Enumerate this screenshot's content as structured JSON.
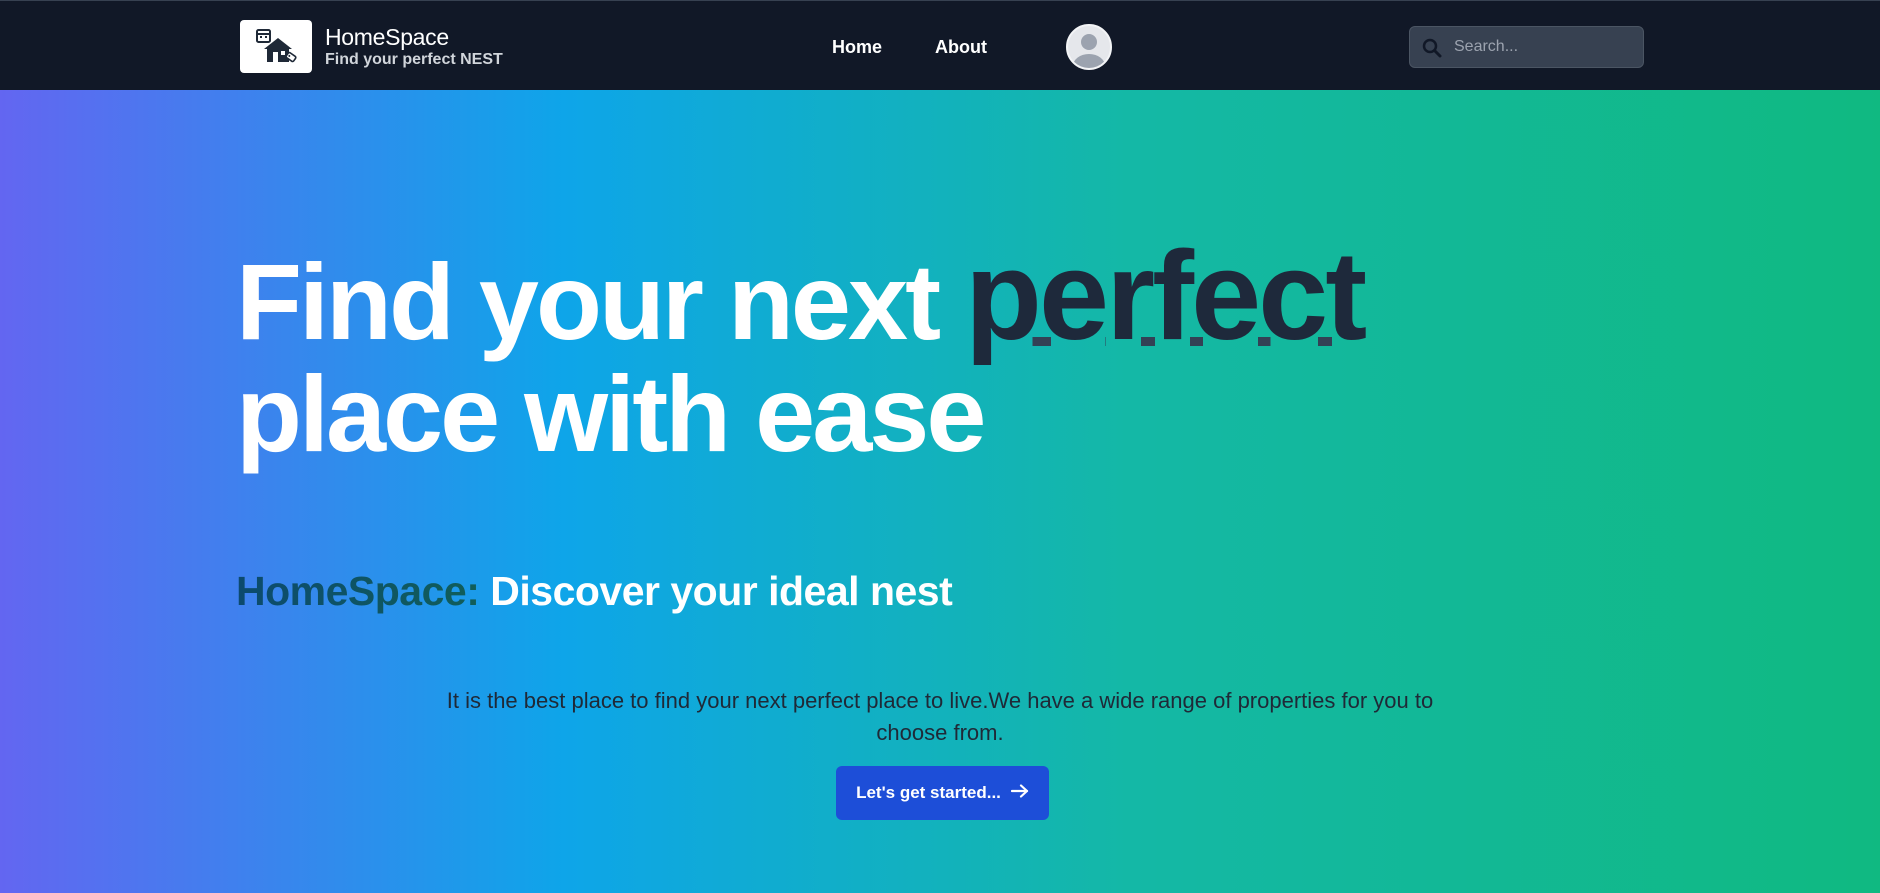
{
  "brand": {
    "logo_icon": "house-calendar-tag-icon",
    "name": "HomeSpace",
    "tagline": "Find your perfect NEST"
  },
  "nav": {
    "items": [
      {
        "label": "Home"
      },
      {
        "label": "About"
      }
    ],
    "avatar_icon": "user-avatar-icon"
  },
  "search": {
    "placeholder": "Search...",
    "value": "",
    "icon": "search-icon"
  },
  "hero": {
    "headline_start": "Find your next",
    "headline_accent": "perfect",
    "headline_end": "place with ease",
    "subhead_brand": "HomeSpace:",
    "subhead_text": "Discover your ideal nest",
    "description": "It is the best place to find your next perfect place to live.We have a wide range of properties for you to choose from.",
    "cta_label": "Let's get started...",
    "cta_icon": "arrow-right-icon"
  },
  "colors": {
    "navbar_bg": "#111827",
    "gradient_start": "#6366f1",
    "gradient_mid": "#0ea5e9",
    "gradient_end": "#10b981",
    "accent_text": "#1e293b",
    "cta_bg": "#1d4ed8"
  }
}
